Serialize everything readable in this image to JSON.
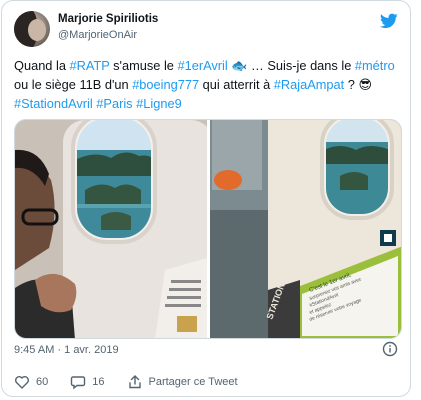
{
  "author": {
    "name": "Marjorie Spiriliotis",
    "handle": "@MarjorieOnAir"
  },
  "tweet": {
    "text_segments": [
      {
        "t": "Quand la ",
        "tag": false
      },
      {
        "t": "#RATP",
        "tag": true
      },
      {
        "t": " s'amuse le ",
        "tag": false
      },
      {
        "t": "#1erAvril",
        "tag": true
      },
      {
        "t": " ",
        "tag": false
      },
      {
        "t": "🐟",
        "tag": false,
        "emoji": true
      },
      {
        "t": " … Suis-je dans le ",
        "tag": false
      },
      {
        "t": "#métro",
        "tag": true
      },
      {
        "t": " ou le siège 11B d'un ",
        "tag": false
      },
      {
        "t": "#boeing777",
        "tag": true
      },
      {
        "t": " qui atterrit à ",
        "tag": false
      },
      {
        "t": "#RajaAmpat",
        "tag": true
      },
      {
        "t": " ? ",
        "tag": false
      },
      {
        "t": "😎",
        "tag": false,
        "emoji": true
      },
      {
        "t": " ",
        "tag": false
      },
      {
        "t": "#StationdAvril",
        "tag": true
      },
      {
        "t": " ",
        "tag": false
      },
      {
        "t": "#Paris",
        "tag": true
      },
      {
        "t": " ",
        "tag": false
      },
      {
        "t": "#Ligne9",
        "tag": true
      }
    ]
  },
  "media": {
    "sign_title": "C'est le 1er avril,",
    "sign_lines": [
      "surprenez vos amis avec",
      "#StationdAvril",
      "et appelez",
      "de réserver votre voyage"
    ],
    "station_sign": "STATION D'AVRIL"
  },
  "meta": {
    "time": "9:45 AM",
    "separator": " · ",
    "date": "1 avr. 2019"
  },
  "actions": {
    "likes": "60",
    "replies": "16",
    "share_label": "Partager ce Tweet"
  },
  "colors": {
    "link": "#1d9bf0",
    "text": "#0f1419",
    "secondary": "#536471",
    "border": "#cfd9de",
    "like_red": "#f91880"
  }
}
